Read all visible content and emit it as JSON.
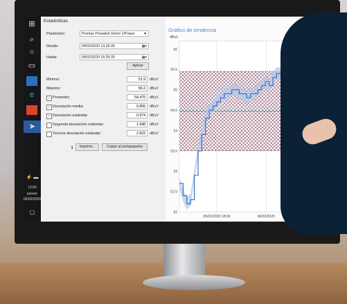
{
  "app": {
    "title": "Estadísticas"
  },
  "form": {
    "parametro_label": "Parámetro:",
    "parametro_value": "Promax Prowatch Demo 1/Power",
    "desde_label": "Desde:",
    "desde_value": "05/02/2020 13:29:39",
    "hasta_label": "Hasta:",
    "hasta_value": "06/02/2020 16:29:39",
    "apply_label": "Aplicar"
  },
  "stats": {
    "minimo_label": "Mínimo:",
    "minimo_value": "51.9",
    "maximo_label": "Máximo:",
    "maximo_value": "56.2",
    "promedio_label": "Promedio:",
    "promedio_value": "54.475",
    "desv_media_label": "Desviación media:",
    "desv_media_value": "0.855",
    "desv_estandar_label": "Desviación estándar:",
    "desv_estandar_value": "0.974",
    "segunda_label": "Segunda desviación estándar:",
    "segunda_value": "1.948",
    "tercera_label": "Tercera desviación estándar:",
    "tercera_value": "2.922",
    "unit": "dBuV"
  },
  "actions": {
    "print_label": "Imprimir...",
    "copy_label": "Copiar al portapapeles"
  },
  "taskbar": {
    "time": "13:00",
    "day": "jueves",
    "date": "06/02/2020"
  },
  "chart_data": {
    "type": "line",
    "title": "Gráfico de tendencia",
    "ylabel": "dBuV",
    "ylim": [
      52,
      56.2
    ],
    "yticks": [
      "56",
      "55.5",
      "55",
      "54.5",
      "54",
      "53.5",
      "53",
      "52.5",
      "52"
    ],
    "xticks": [
      "05/02/2020 18:00",
      "06/02/2020"
    ],
    "bands": {
      "lower": 53.5,
      "mean": 54.475,
      "upper": 55.45
    },
    "series": [
      {
        "x": [
          0,
          1,
          2,
          3,
          4,
          5,
          6,
          7,
          8,
          9,
          10,
          11,
          12,
          13,
          14,
          15,
          16,
          17,
          18,
          19,
          20,
          21,
          22,
          23,
          24,
          25,
          26,
          27,
          28,
          29,
          30,
          31,
          32,
          33,
          34,
          35,
          36,
          37,
          38,
          39,
          40
        ],
        "values": [
          52.7,
          52.4,
          52.2,
          52.3,
          52.9,
          53.5,
          53.9,
          54.3,
          54.5,
          54.6,
          54.7,
          54.8,
          54.9,
          54.9,
          55.0,
          55.0,
          54.9,
          54.9,
          54.8,
          54.9,
          54.9,
          55.0,
          55.1,
          55.2,
          55.1,
          55.3,
          55.4,
          55.4,
          55.5,
          55.4,
          55.6,
          55.5,
          55.7,
          55.6,
          55.6,
          55.8,
          55.7,
          55.6,
          55.7,
          55.8,
          55.7
        ]
      }
    ],
    "colors": {
      "line": "#3d6fc4",
      "band": "#b2c7ea",
      "hatch": "#6a1f3f"
    }
  }
}
